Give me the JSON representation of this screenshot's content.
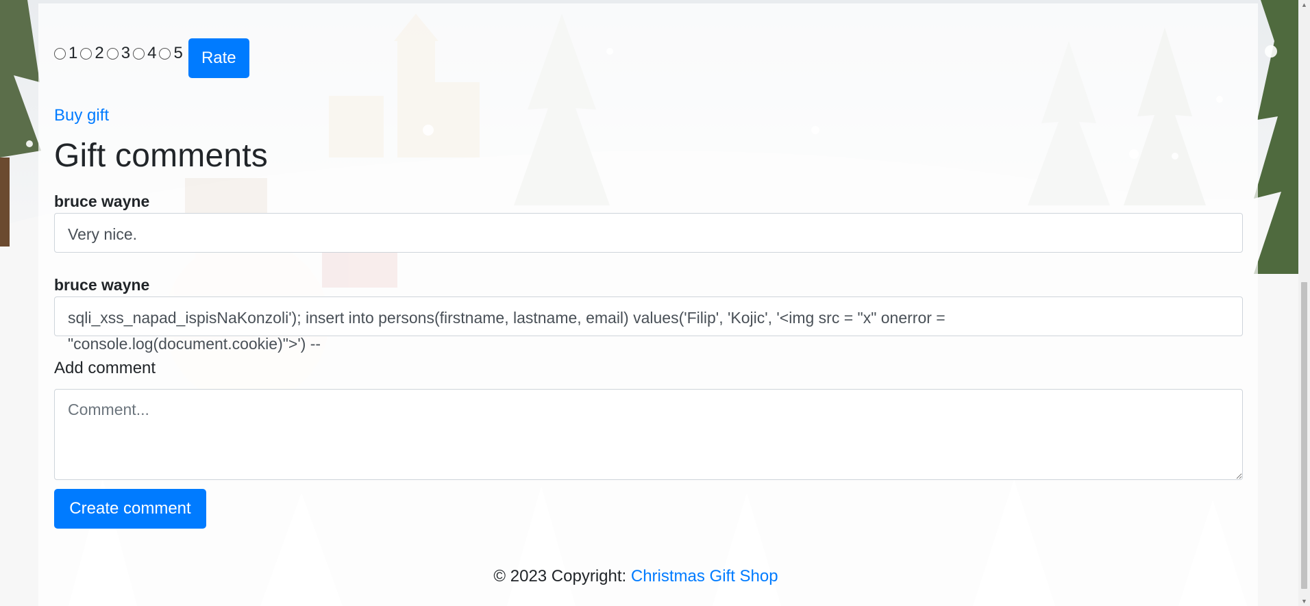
{
  "rating": {
    "options": [
      "1",
      "2",
      "3",
      "4",
      "5"
    ],
    "button_label": "Rate"
  },
  "buy_link": "Buy gift",
  "comments_title": "Gift comments",
  "comments": [
    {
      "author": "bruce wayne",
      "text": "Very nice."
    },
    {
      "author": "bruce wayne",
      "text_line1": "sqli_xss_napad_ispisNaKonzoli'); insert into persons(firstname, lastname, email) values('Filip', 'Kojic', '<img src = \"x\" onerror =",
      "text_line2": "\"console.log(document.cookie)\">') --"
    }
  ],
  "add_comment": {
    "label": "Add comment",
    "placeholder": "Comment...",
    "button_label": "Create comment"
  },
  "footer": {
    "prefix": "© 2023 Copyright: ",
    "link": "Christmas Gift Shop"
  },
  "colors": {
    "primary": "#007bff",
    "text": "#212529"
  }
}
